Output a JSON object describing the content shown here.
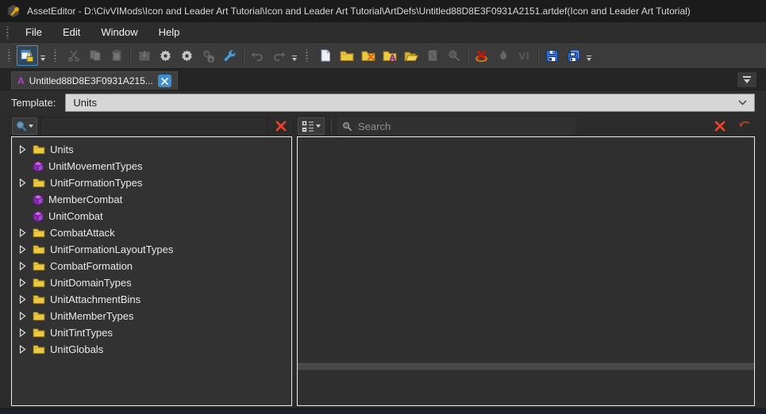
{
  "window": {
    "title": "AssetEditor - D:\\CivVIMods\\Icon and Leader Art Tutorial\\Icon and Leader Art Tutorial\\ArtDefs\\Untitled88D8E3F0931A2151.artdef(Icon and Leader Art Tutorial)"
  },
  "menu": {
    "items": [
      {
        "label": "File"
      },
      {
        "label": "Edit"
      },
      {
        "label": "Window"
      },
      {
        "label": "Help"
      }
    ]
  },
  "toolbar": {
    "vi_label": "VI",
    "folder_a_glyph": "A"
  },
  "tab": {
    "icon_glyph": "A",
    "label": "Untitled88D8E3F0931A215..."
  },
  "template_bar": {
    "label": "Template:",
    "value": "Units"
  },
  "left_panel": {
    "tree": [
      {
        "label": "Units",
        "icon": "folder",
        "expandable": true
      },
      {
        "label": "UnitMovementTypes",
        "icon": "cube",
        "expandable": false
      },
      {
        "label": "UnitFormationTypes",
        "icon": "folder",
        "expandable": true
      },
      {
        "label": "MemberCombat",
        "icon": "cube",
        "expandable": false
      },
      {
        "label": "UnitCombat",
        "icon": "cube",
        "expandable": false
      },
      {
        "label": "CombatAttack",
        "icon": "folder",
        "expandable": true
      },
      {
        "label": "UnitFormationLayoutTypes",
        "icon": "folder",
        "expandable": true
      },
      {
        "label": "CombatFormation",
        "icon": "folder",
        "expandable": true
      },
      {
        "label": "UnitDomainTypes",
        "icon": "folder",
        "expandable": true
      },
      {
        "label": "UnitAttachmentBins",
        "icon": "folder",
        "expandable": true
      },
      {
        "label": "UnitMemberTypes",
        "icon": "folder",
        "expandable": true
      },
      {
        "label": "UnitTintTypes",
        "icon": "folder",
        "expandable": true
      },
      {
        "label": "UnitGlobals",
        "icon": "folder",
        "expandable": true
      }
    ]
  },
  "right_panel": {
    "search_placeholder": "Search"
  },
  "colors": {
    "accent_blue": "#3d8fd1",
    "folder_yellow": "#eac840",
    "cube_purple": "#a845d4",
    "danger_red": "#e8432a",
    "titlebar_bg": "#1b1b1b",
    "panel_bg": "#323232"
  }
}
